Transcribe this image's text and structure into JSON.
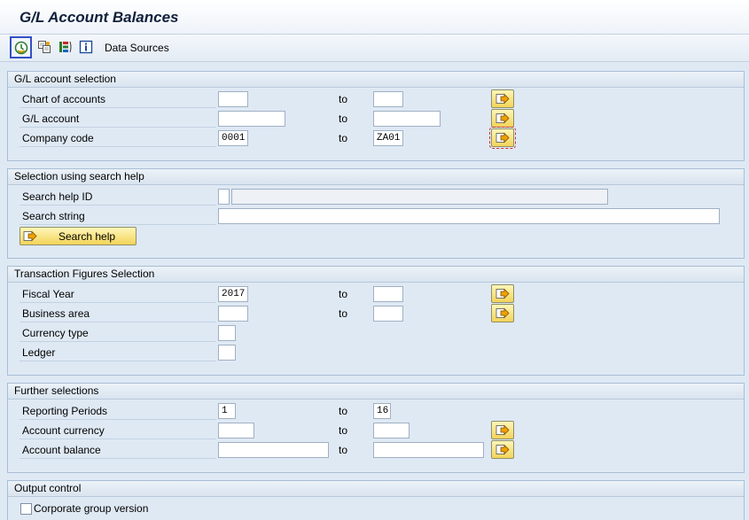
{
  "window": {
    "title": "G/L Account Balances"
  },
  "toolbar": {
    "execute_icon": "execute-clock-icon",
    "get_variant_icon": "get-variant-icon",
    "selection_options_icon": "selection-options-icon",
    "info_icon": "info-icon",
    "data_sources_label": "Data Sources"
  },
  "common": {
    "to_label": "to",
    "arrow_icon": "multiple-selection-arrow-icon"
  },
  "gl_selection": {
    "header": "G/L account selection",
    "chart_of_accounts": {
      "label": "Chart of accounts",
      "from": "",
      "to": ""
    },
    "gl_account": {
      "label": "G/L account",
      "from": "",
      "to": ""
    },
    "company_code": {
      "label": "Company code",
      "from": "0001",
      "to": "ZA01"
    }
  },
  "search_help": {
    "header": "Selection using search help",
    "search_help_id": {
      "label": "Search help ID",
      "value": "",
      "description": ""
    },
    "search_string": {
      "label": "Search string",
      "value": ""
    },
    "button_label": "Search help"
  },
  "transaction_figures": {
    "header": "Transaction Figures Selection",
    "fiscal_year": {
      "label": "Fiscal Year",
      "from": "2017",
      "to": ""
    },
    "business_area": {
      "label": "Business area",
      "from": "",
      "to": ""
    },
    "currency_type": {
      "label": "Currency type",
      "value": ""
    },
    "ledger": {
      "label": "Ledger",
      "value": ""
    }
  },
  "further_selections": {
    "header": "Further selections",
    "reporting_periods": {
      "label": "Reporting Periods",
      "from": "1",
      "to": "16"
    },
    "account_currency": {
      "label": "Account currency",
      "from": "",
      "to": ""
    },
    "account_balance": {
      "label": "Account balance",
      "from": "",
      "to": ""
    }
  },
  "output_control": {
    "header": "Output control",
    "corporate_group_version": {
      "label": "Corporate group version",
      "checked": false
    }
  },
  "colors": {
    "background": "#dfe9f4",
    "button_yellow": "#f3d45a",
    "focus_blue": "#3150c5"
  }
}
